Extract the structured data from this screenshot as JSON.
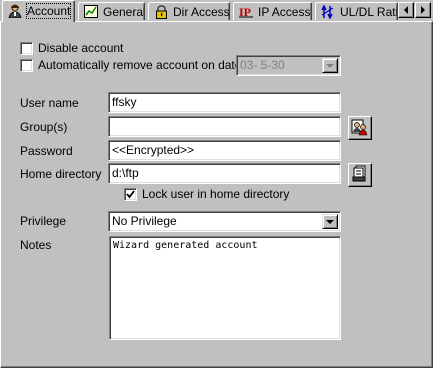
{
  "tabs": [
    {
      "label": "Account",
      "icon": "user-account-icon",
      "active": true
    },
    {
      "label": "General",
      "icon": "general-chart-icon",
      "active": false
    },
    {
      "label": "Dir Access",
      "icon": "lock-icon",
      "active": false
    },
    {
      "label": "IP Access",
      "icon": "ip-icon",
      "active": false
    },
    {
      "label": "UL/DL Rati",
      "icon": "ratio-arrows-icon",
      "active": false
    }
  ],
  "tab_scroll": {
    "left_icon": "arrow-left-icon",
    "right_icon": "arrow-right-icon"
  },
  "account": {
    "disable_account": {
      "label": "Disable account",
      "checked": false
    },
    "auto_remove": {
      "label": "Automatically remove account on date",
      "checked": false
    },
    "remove_date": "03-  5-30"
  },
  "fields": {
    "user_name": {
      "label": "User name",
      "value": "ffsky"
    },
    "groups": {
      "label": "Group(s)",
      "value": ""
    },
    "password": {
      "label": "Password",
      "value": "<<Encrypted>>"
    },
    "home_directory": {
      "label": "Home directory",
      "value": "d:\\ftp"
    },
    "lock_home": {
      "label": "Lock user in home directory",
      "checked": true
    },
    "privilege": {
      "label": "Privilege",
      "value": "No Privilege"
    },
    "notes": {
      "label": "Notes",
      "value": "Wizard generated account"
    }
  },
  "buttons": {
    "groups_picker_icon": "group-picker-icon",
    "home_dir_browse_icon": "folder-browse-icon"
  }
}
